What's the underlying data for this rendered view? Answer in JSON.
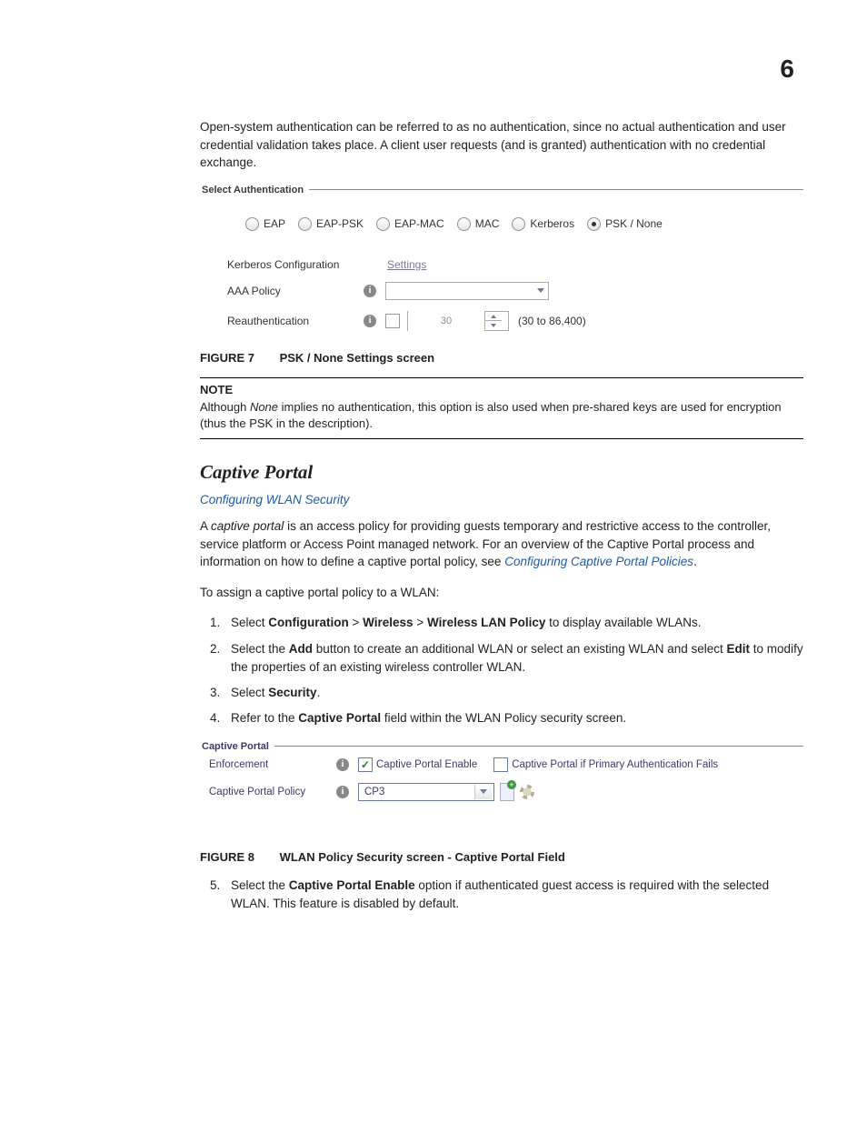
{
  "page_number": "6",
  "intro_para": "Open-system authentication can be referred to as no authentication, since no actual authentication and user credential validation takes place. A client user requests (and is granted) authentication with no credential exchange.",
  "fig7": {
    "fieldset_title": "Select Authentication",
    "radios": {
      "eap": "EAP",
      "eap_psk": "EAP-PSK",
      "eap_mac": "EAP-MAC",
      "mac": "MAC",
      "kerberos": "Kerberos",
      "psk_none": "PSK / None"
    },
    "kerberos_label": "Kerberos Configuration",
    "settings_link": "Settings",
    "aaa_label": "AAA Policy",
    "reauth_label": "Reauthentication",
    "reauth_value": "30",
    "reauth_range": "(30 to 86,400)"
  },
  "fig7_caption_label": "FIGURE 7",
  "fig7_caption_title": "PSK / None Settings screen",
  "note_head": "NOTE",
  "note_body_1": "Although ",
  "note_body_italic": "None",
  "note_body_2": " implies no authentication, this option is also used when pre-shared keys are used for encryption (thus the PSK in the description).",
  "section_heading": "Captive Portal",
  "subheading_link": "Configuring WLAN Security",
  "para1_a": "A ",
  "para1_ital": "captive portal",
  "para1_b": " is an access policy for providing guests temporary and restrictive access to the controller, service platform or Access Point managed network. For an overview of the Captive Portal process and information on how to define a captive portal policy, see ",
  "para1_link": "Configuring Captive Portal Policies",
  "para1_c": ".",
  "para2": "To assign a captive portal policy to a WLAN:",
  "steps": {
    "s1_a": "Select ",
    "s1_b1": "Configuration",
    "s1_sep": " > ",
    "s1_b2": "Wireless",
    "s1_b3": "Wireless LAN Policy",
    "s1_c": " to display available WLANs.",
    "s2_a": "Select the ",
    "s2_b1": "Add",
    "s2_b": " button to create an additional WLAN or select an existing WLAN and select ",
    "s2_b2": "Edit",
    "s2_c": " to modify the properties of an existing wireless controller WLAN.",
    "s3_a": "Select ",
    "s3_b": "Security",
    "s3_c": ".",
    "s4_a": "Refer to the ",
    "s4_b": "Captive Portal",
    "s4_c": " field within the WLAN Policy security screen."
  },
  "fig8": {
    "fieldset_title": "Captive Portal",
    "enforcement_label": "Enforcement",
    "cp_enable": "Captive Portal Enable",
    "cp_fail": "Captive Portal if Primary Authentication Fails",
    "policy_label": "Captive Portal Policy",
    "policy_value": "CP3"
  },
  "fig8_caption_label": "FIGURE 8",
  "fig8_caption_title": "WLAN Policy Security screen - Captive Portal Field",
  "step5_a": "Select the ",
  "step5_b": "Captive Portal Enable",
  "step5_c": " option if authenticated guest access is required with the selected WLAN. This feature is disabled by default."
}
